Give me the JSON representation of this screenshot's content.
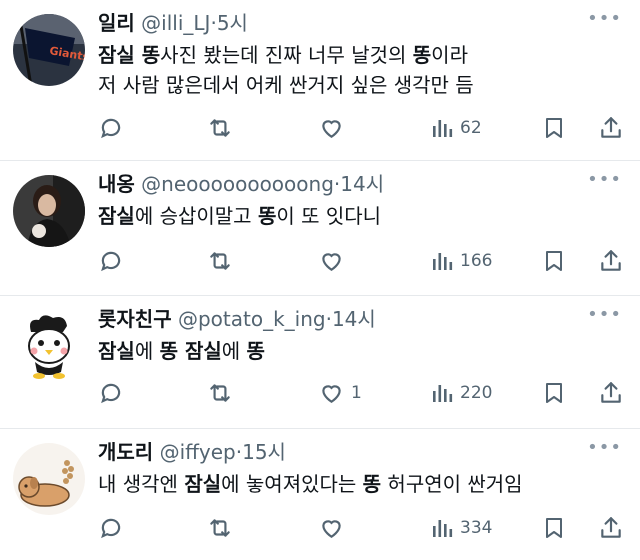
{
  "tweets": [
    {
      "name": "일리",
      "handle": "@illi_LJ",
      "time": "5시",
      "body_lines": [
        [
          {
            "t": "잠실 똥",
            "b": true
          },
          {
            "t": "사진 봤는데 진짜 너무 날것의 ",
            "b": false
          },
          {
            "t": "똥",
            "b": true
          },
          {
            "t": "이라",
            "b": false
          }
        ],
        [
          {
            "t": "저 사람 많은데서 어케 싼거지 싶은 생각만 듬",
            "b": false
          }
        ]
      ],
      "likes": "",
      "views": "62",
      "avatar": "baseball-flag"
    },
    {
      "name": "내옹",
      "handle": "@neoooooooooong",
      "time": "14시",
      "body_lines": [
        [
          {
            "t": "잠실",
            "b": true
          },
          {
            "t": "에 승삽이말고 ",
            "b": false
          },
          {
            "t": "똥",
            "b": true
          },
          {
            "t": "이 또 잇다니",
            "b": false
          }
        ]
      ],
      "likes": "",
      "views": "166",
      "avatar": "person-photo"
    },
    {
      "name": "롯자친구",
      "handle": "@potato_k_ing",
      "time": "14시",
      "body_lines": [
        [
          {
            "t": "잠실",
            "b": true
          },
          {
            "t": "에 ",
            "b": false
          },
          {
            "t": "똥 잠실",
            "b": true
          },
          {
            "t": "에 ",
            "b": false
          },
          {
            "t": "똥",
            "b": true
          }
        ]
      ],
      "likes": "1",
      "views": "220",
      "avatar": "penguin-character"
    },
    {
      "name": "개도리",
      "handle": "@iffyep",
      "time": "15시",
      "body_lines": [
        [
          {
            "t": "내 생각엔 ",
            "b": false
          },
          {
            "t": "잠실",
            "b": true
          },
          {
            "t": "에 놓여져있다는 ",
            "b": false
          },
          {
            "t": "똥",
            "b": true
          },
          {
            "t": " 허구연이 싼거임",
            "b": false
          }
        ]
      ],
      "likes": "",
      "views": "334",
      "avatar": "dog-character"
    }
  ],
  "separator": "·",
  "more_glyph": "•••",
  "colors": {
    "text": "#0f1419",
    "secondary": "#536471",
    "border": "#e6e9ec"
  }
}
